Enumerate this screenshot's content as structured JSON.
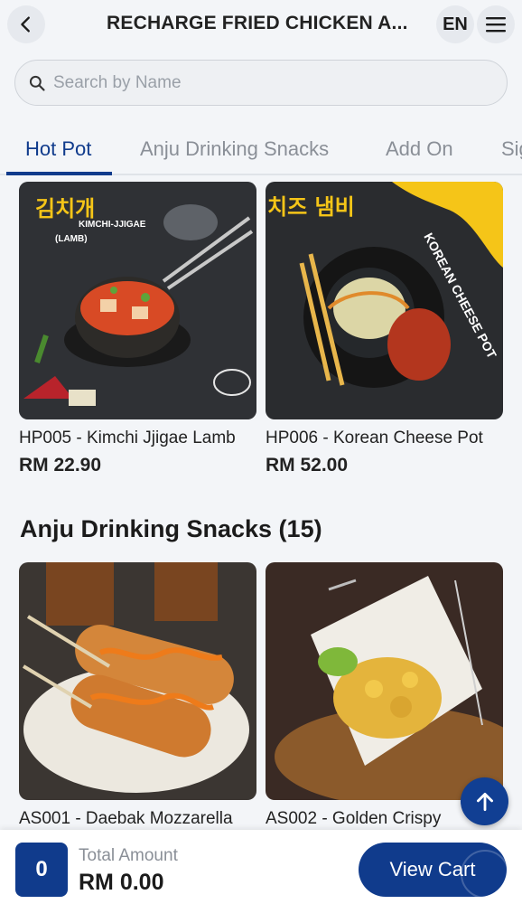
{
  "header": {
    "title": "RECHARGE FRIED CHICKEN A...",
    "lang": "EN",
    "icons": {
      "back": "chevron-left-icon",
      "menu": "hamburger-menu-icon"
    }
  },
  "search": {
    "placeholder": "Search by Name",
    "value": ""
  },
  "tabs": [
    {
      "label": "Hot Pot",
      "active": true
    },
    {
      "label": "Anju Drinking Snacks",
      "active": false
    },
    {
      "label": "Add On",
      "active": false
    },
    {
      "label": "Sig",
      "active": false
    }
  ],
  "hot_pot_items": [
    {
      "name": "HP005 - Kimchi Jjigae Lamb",
      "price": "RM 22.90",
      "image_text": [
        "김치개",
        "KIMCHI-JJIGAE",
        "(LAMB)"
      ]
    },
    {
      "name": "HP006 - Korean Cheese Pot",
      "price": "RM 52.00",
      "image_text": [
        "치즈 냄비",
        "KOREAN CHEESE POT"
      ]
    }
  ],
  "section": {
    "title": "Anju Drinking Snacks (15)"
  },
  "anju_items": [
    {
      "name": "AS001 - Daebak Mozzarella"
    },
    {
      "name": "AS002 - Golden Crispy"
    }
  ],
  "footer": {
    "count": "0",
    "total_label": "Total Amount",
    "total_value": "RM 0.00",
    "view_cart": "View Cart"
  },
  "colors": {
    "brand": "#103b8c",
    "background": "#f3f5f8",
    "inactive_tab": "#8a8f97"
  }
}
